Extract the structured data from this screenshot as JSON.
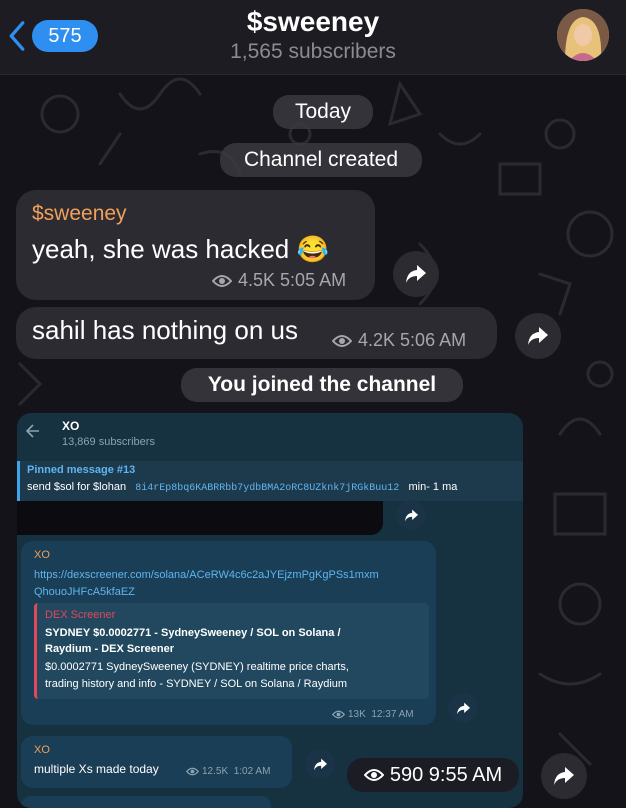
{
  "header": {
    "back_count": "575",
    "channel_name": "$sweeney",
    "subscribers": "1,565 subscribers"
  },
  "service": {
    "today": "Today",
    "created": "Channel created",
    "joined": "You joined the channel"
  },
  "messages": [
    {
      "author": "$sweeney",
      "text": "yeah, she was hacked",
      "emoji": "😂",
      "views": "4.5K",
      "time": "5:05 AM"
    },
    {
      "text": "sahil has nothing on us",
      "views": "4.2K",
      "time": "5:06 AM"
    }
  ],
  "embed": {
    "channel_name": "XO",
    "subscribers": "13,869 subscribers",
    "pinned_title": "Pinned message #13",
    "pinned_text": "send $sol for $lohan",
    "pinned_address": "8i4rEp8bq6KABRRbb7ydbBMA2oRC8UZknk7jRGkBuu12",
    "pinned_suffix": "min- 1  ma",
    "posts": [
      {
        "author": "XO",
        "link_line1": "https://dexscreener.com/solana/ACeRW4c6c2aJYEjzmPgKgPSs1mxm",
        "link_line2": "QhouoJHFcA5kfaEZ",
        "preview_site": "DEX Screener",
        "preview_title": "SYDNEY $0.0002771 - SydneySweeney / SOL on Solana / Raydium - DEX Screener",
        "preview_desc": "$0.0002771 SydneySweeney (SYDNEY) realtime price charts, trading history and info - SYDNEY / SOL on Solana / Raydium",
        "views": "13K",
        "time": "12:37 AM"
      },
      {
        "author": "XO",
        "text": "multiple Xs made today",
        "views": "12.5K",
        "time": "1:02 AM"
      }
    ]
  },
  "last_message": {
    "views": "590",
    "time": "9:55 AM"
  },
  "colors": {
    "accent": "#2f8ff0",
    "author": "#f0a05a",
    "bubble": "#2c2b31",
    "background": "#14131a"
  }
}
